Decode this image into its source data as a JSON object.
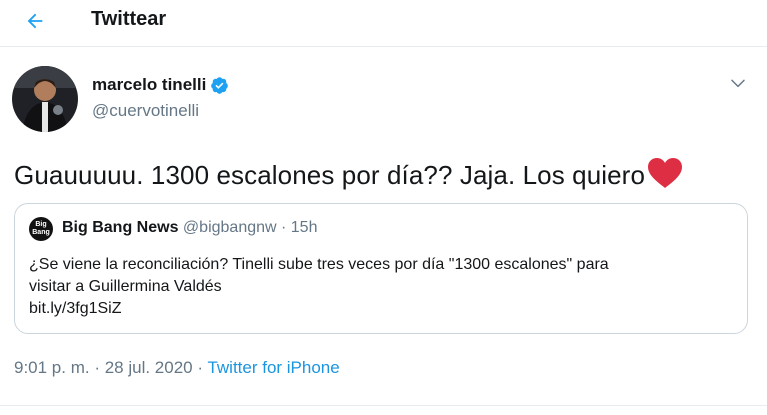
{
  "header": {
    "title": "Twittear"
  },
  "author": {
    "name": "marcelo tinelli",
    "handle": "@cuervotinelli"
  },
  "tweet": {
    "text": "Guauuuuu. 1300 escalones por día?? Jaja. Los quiero"
  },
  "quoted": {
    "avatar_line1": "Big",
    "avatar_line2": "Bang",
    "name": "Big Bang News",
    "handle": "@bigbangnw",
    "separator": " · ",
    "time": "15h",
    "text_line1": "¿Se viene la reconciliación? Tinelli sube tres veces por día \"1300 escalones\" para",
    "text_line2": "visitar a Guillermina Valdés",
    "link": "bit.ly/3fg1SiZ"
  },
  "meta": {
    "time": "9:01 p. m.",
    "separator": " · ",
    "date": "28 jul. 2020",
    "source": "Twitter for iPhone"
  },
  "colors": {
    "accent": "#1da1f2",
    "link": "#1b95e0",
    "heart": "#e0245e",
    "muted": "#657786"
  },
  "icons": [
    "back-arrow-icon",
    "verified-badge-icon",
    "chevron-down-icon",
    "red-heart-emoji"
  ]
}
